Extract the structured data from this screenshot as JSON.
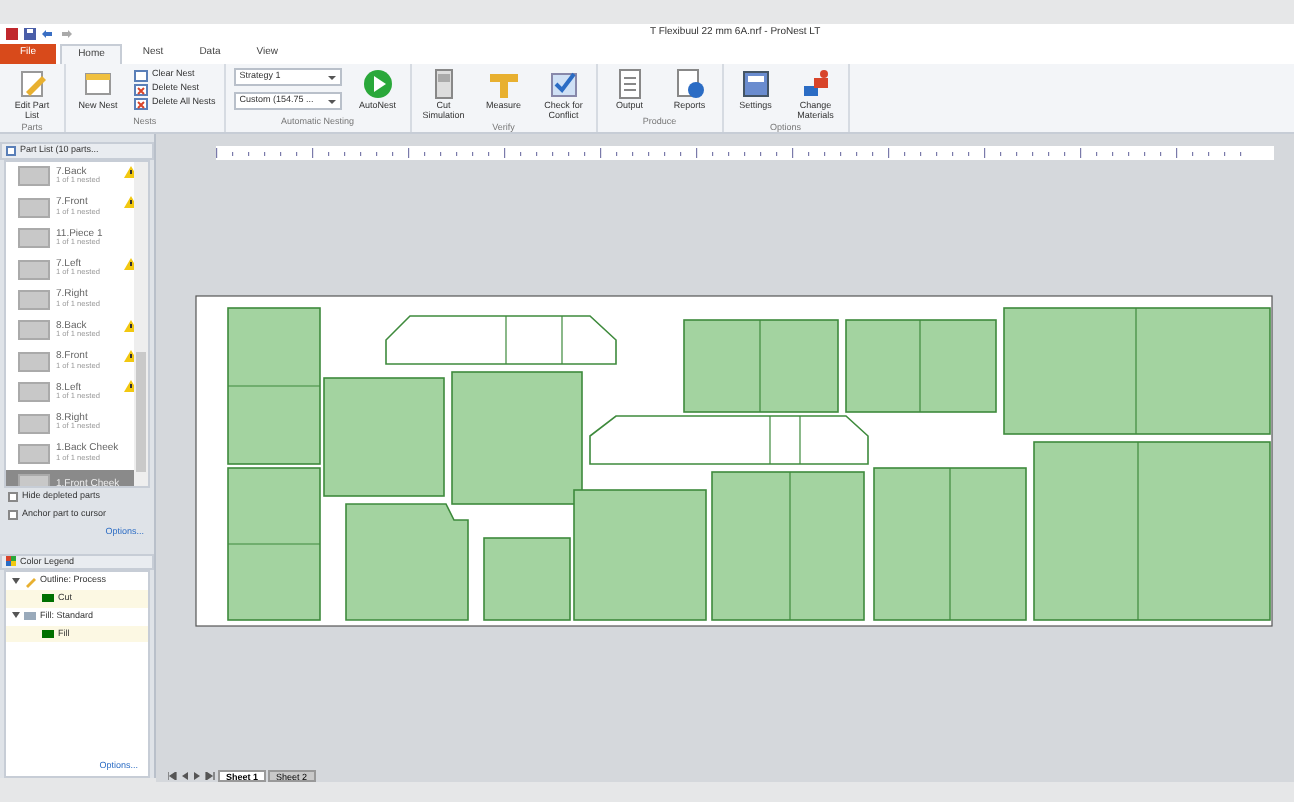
{
  "window": {
    "title": "T Flexibuul 22 mm 6A.nrf - ProNest LT"
  },
  "ribbon_tabs": [
    {
      "label": "File",
      "kind": "file",
      "selected": false
    },
    {
      "label": "Home",
      "kind": "tab",
      "selected": true
    },
    {
      "label": "Nest",
      "kind": "tab",
      "selected": false
    },
    {
      "label": "Data",
      "kind": "tab",
      "selected": false
    },
    {
      "label": "View",
      "kind": "tab",
      "selected": false
    }
  ],
  "ribbon_groups": [
    {
      "label": "Parts",
      "items": [
        {
          "kind": "big",
          "label": "Edit Part List"
        }
      ]
    },
    {
      "label": "Nests",
      "items": [
        {
          "kind": "big",
          "label": "New Nest"
        },
        {
          "kind": "stack",
          "labels": [
            "Clear Nest",
            "Delete Nest",
            "Delete All Nests"
          ]
        }
      ]
    },
    {
      "label": "Automatic Nesting",
      "items": [
        {
          "kind": "combos",
          "values": [
            "Strategy 1",
            "Custom (154.75 ..."
          ]
        },
        {
          "kind": "big",
          "label": "AutoNest"
        }
      ]
    },
    {
      "label": "Verify",
      "items": [
        {
          "kind": "big",
          "label": "Cut Simulation"
        },
        {
          "kind": "big",
          "label": "Measure"
        },
        {
          "kind": "big",
          "label": "Check for Conflict"
        }
      ]
    },
    {
      "label": "Produce",
      "items": [
        {
          "kind": "big",
          "label": "Output"
        },
        {
          "kind": "big",
          "label": "Reports"
        }
      ]
    },
    {
      "label": "Options",
      "items": [
        {
          "kind": "big",
          "label": "Settings"
        },
        {
          "kind": "big",
          "label": "Change Materials"
        }
      ]
    }
  ],
  "part_list": {
    "title": "Part List (10 parts...",
    "items": [
      {
        "name": "7.Back",
        "status": "1 of 1 nested",
        "warning": true,
        "selected": false
      },
      {
        "name": "7.Front",
        "status": "1 of 1 nested",
        "warning": true,
        "selected": false
      },
      {
        "name": "11.Piece 1",
        "status": "1 of 1 nested",
        "warning": false,
        "selected": false
      },
      {
        "name": "7.Left",
        "status": "1 of 1 nested",
        "warning": true,
        "selected": false
      },
      {
        "name": "7.Right",
        "status": "1 of 1 nested",
        "warning": false,
        "selected": false
      },
      {
        "name": "8.Back",
        "status": "1 of 1 nested",
        "warning": true,
        "selected": false
      },
      {
        "name": "8.Front",
        "status": "1 of 1 nested",
        "warning": true,
        "selected": false
      },
      {
        "name": "8.Left",
        "status": "1 of 1 nested",
        "warning": true,
        "selected": false
      },
      {
        "name": "8.Right",
        "status": "1 of 1 nested",
        "warning": false,
        "selected": false
      },
      {
        "name": "1.Back Cheek",
        "status": "1 of 1 nested",
        "warning": false,
        "selected": false
      },
      {
        "name": "1.Front Cheek",
        "warning": false,
        "selected": true
      }
    ],
    "options": [
      {
        "label": "Hide depleted parts",
        "checked": false
      },
      {
        "label": "Anchor part to cursor",
        "checked": false
      }
    ],
    "link": "Options..."
  },
  "color_legend": {
    "title": "Color Legend",
    "groups": [
      {
        "label": "Outline: Process",
        "expanded": true,
        "children": [
          {
            "label": "Cut",
            "color": "#007000"
          }
        ]
      },
      {
        "label": "Fill: Standard",
        "expanded": true,
        "children": [
          {
            "label": "Fill",
            "color": "#007000"
          }
        ]
      }
    ],
    "link": "Options..."
  },
  "sheet_tabs": [
    {
      "label": "Sheet 1",
      "selected": true
    },
    {
      "label": "Sheet 2",
      "selected": false
    }
  ]
}
